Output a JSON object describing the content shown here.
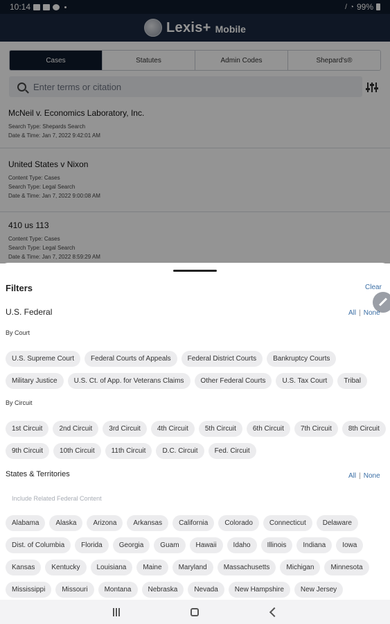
{
  "status_bar": {
    "time": "10:14",
    "battery": "99%"
  },
  "header": {
    "brand": "Lexis+",
    "brand_sub": "Mobile"
  },
  "tabs": [
    {
      "label": "Cases",
      "active": true
    },
    {
      "label": "Statutes",
      "active": false
    },
    {
      "label": "Admin Codes",
      "active": false
    },
    {
      "label": "Shepard's®",
      "active": false
    }
  ],
  "search": {
    "placeholder": "Enter terms or citation"
  },
  "results": [
    {
      "title": "McNeil v. Economics Laboratory, Inc.",
      "meta": [
        "Search Type: Shepards Search",
        "Date & Time: Jan 7, 2022 9:42:01 AM"
      ]
    },
    {
      "title": "United States v Nixon",
      "meta": [
        "Content Type: Cases",
        "Search Type: Legal Search",
        "Date & Time: Jan 7, 2022 9:00:08 AM"
      ]
    },
    {
      "title": "410 us 113",
      "meta": [
        "Content Type: Cases",
        "Search Type: Legal Search",
        "Date & Time: Jan 7, 2022 8:59:29 AM"
      ]
    }
  ],
  "filters": {
    "title": "Filters",
    "clear_label": "Clear",
    "federal": {
      "title": "U.S. Federal",
      "all_label": "All",
      "none_label": "None",
      "by_court_label": "By Court",
      "courts": [
        "U.S. Supreme Court",
        "Federal Courts of Appeals",
        "Federal District Courts",
        "Bankruptcy Courts",
        "Military Justice",
        "U.S. Ct. of App. for Veterans Claims",
        "Other Federal Courts",
        "U.S. Tax Court",
        "Tribal"
      ],
      "by_circuit_label": "By Circuit",
      "circuits": [
        "1st Circuit",
        "2nd Circuit",
        "3rd Circuit",
        "4th Circuit",
        "5th Circuit",
        "6th Circuit",
        "7th Circuit",
        "8th Circuit",
        "9th Circuit",
        "10th Circuit",
        "11th Circuit",
        "D.C. Circuit",
        "Fed. Circuit"
      ]
    },
    "states": {
      "title": "States & Territories",
      "all_label": "All",
      "none_label": "None",
      "include_label": "Include Related Federal Content",
      "items": [
        "Alabama",
        "Alaska",
        "Arizona",
        "Arkansas",
        "California",
        "Colorado",
        "Connecticut",
        "Delaware",
        "Dist. of Columbia",
        "Florida",
        "Georgia",
        "Guam",
        "Hawaii",
        "Idaho",
        "Illinois",
        "Indiana",
        "Iowa",
        "Kansas",
        "Kentucky",
        "Louisiana",
        "Maine",
        "Maryland",
        "Massachusetts",
        "Michigan",
        "Minnesota",
        "Mississippi",
        "Missouri",
        "Montana",
        "Nebraska",
        "Nevada",
        "New Hampshire",
        "New Jersey"
      ]
    }
  },
  "colors": {
    "header_bg": "#1a2940",
    "active_tab": "#0f1a2b",
    "link": "#3a6ea5",
    "chip_bg": "#ececee"
  }
}
